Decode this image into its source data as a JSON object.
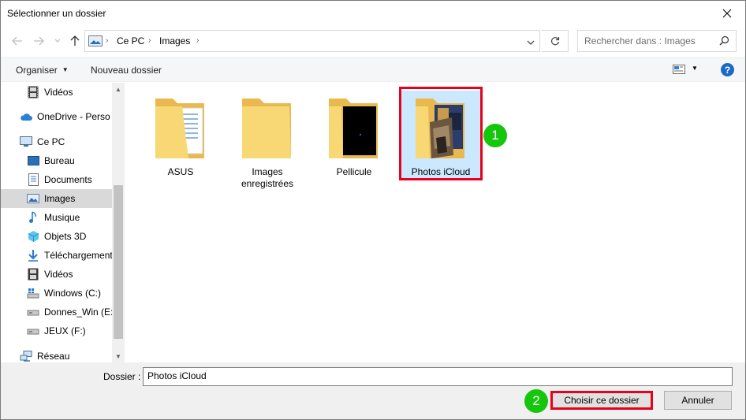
{
  "window": {
    "title": "Sélectionner un dossier"
  },
  "address": {
    "crumbs": [
      "Ce PC",
      "Images"
    ]
  },
  "search": {
    "placeholder": "Rechercher dans : Images"
  },
  "toolbar": {
    "organize_label": "Organiser",
    "new_folder_label": "Nouveau dossier",
    "help_label": "?"
  },
  "navpane": {
    "items": [
      {
        "label": "Vidéos",
        "icon": "video-icon",
        "indent": 1
      },
      {
        "label": "OneDrive - Perso",
        "icon": "cloud-icon",
        "indent": 0
      },
      {
        "label": "Ce PC",
        "icon": "computer-icon",
        "indent": 0
      },
      {
        "label": "Bureau",
        "icon": "desktop-icon",
        "indent": 1
      },
      {
        "label": "Documents",
        "icon": "documents-icon",
        "indent": 1
      },
      {
        "label": "Images",
        "icon": "pictures-icon",
        "indent": 1,
        "selected": true
      },
      {
        "label": "Musique",
        "icon": "music-icon",
        "indent": 1
      },
      {
        "label": "Objets 3D",
        "icon": "cube-icon",
        "indent": 1
      },
      {
        "label": "Téléchargements",
        "icon": "download-icon",
        "indent": 1
      },
      {
        "label": "Vidéos",
        "icon": "video-icon",
        "indent": 1
      },
      {
        "label": "Windows (C:)",
        "icon": "drive-icon",
        "indent": 1
      },
      {
        "label": "Donnes_Win (E:)",
        "icon": "drive-icon",
        "indent": 1
      },
      {
        "label": "JEUX (F:)",
        "icon": "drive-icon",
        "indent": 1
      },
      {
        "label": "Réseau",
        "icon": "network-icon",
        "indent": 0
      }
    ]
  },
  "folders": [
    {
      "label": "ASUS",
      "icon": "folder-documents-icon"
    },
    {
      "label": "Images enregistrées",
      "icon": "folder-icon"
    },
    {
      "label": "Pellicule",
      "icon": "folder-dark-icon"
    },
    {
      "label": "Photos iCloud",
      "icon": "folder-photos-icon",
      "selected": true
    }
  ],
  "badges": {
    "first": "1",
    "second": "2"
  },
  "bottom": {
    "folder_label": "Dossier :",
    "folder_value": "Photos iCloud",
    "choose_label": "Choisir ce dossier",
    "cancel_label": "Annuler"
  },
  "colors": {
    "highlight_red": "#e8001c",
    "badge_green": "#16c60c",
    "selection_blue": "#cce8ff",
    "folder_yellow": "#f8d775"
  }
}
